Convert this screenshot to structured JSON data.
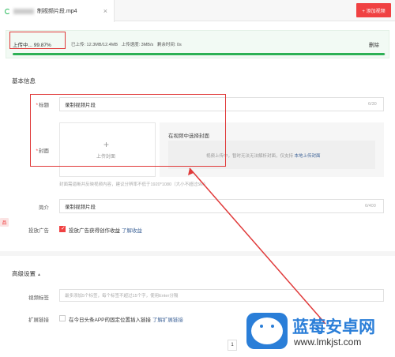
{
  "tab": {
    "file_name": "制视频片段.mp4",
    "close_icon": "×",
    "add_video_label": "+ 添加视频"
  },
  "upload": {
    "status": "上传中... 99.87%",
    "uploaded": "已上传: 12.3MB/12.4MB",
    "speed": "上传速度: 3MB/s",
    "remaining": "剩余时间: 0s",
    "delete_label": "删除",
    "progress_percent": 99.87,
    "progress_color": "#2db155"
  },
  "basic": {
    "section_title": "基本信息",
    "title_label": "标题",
    "title_value": "录制视频片段",
    "title_counter": "6/30",
    "cover_label": "封面",
    "cover_upload_label": "上传封面",
    "cover_choose_title": "在视频中选择封面",
    "cover_choose_msg": "视频上传中，暂时无法无法解析封面，仅支持",
    "cover_choose_link": "本地上传封面",
    "cover_hint": "封面需逼晰并反映视频内容，建议分辨率不低于1920*1080（大小不超过5M）",
    "intro_label": "简介",
    "intro_value": "录制视频片段",
    "intro_counter": "6/400",
    "ad_label": "投放广告",
    "ad_text": "投放广告获得创作收益",
    "ad_link": "了解收益",
    "left_badge": "品"
  },
  "advanced": {
    "section_title": "高级设置",
    "tags_label": "视频标签",
    "tags_placeholder": "最多添加5个标签，每个标签不超过15个字，使用Enter分隔",
    "ext_label": "扩展链接",
    "ext_text": "在今日头条APP的固定位置插入链接",
    "ext_link": "了解扩展链接"
  },
  "pagination": {
    "page": "1"
  },
  "watermark": {
    "brand": "蓝莓安卓网",
    "url": "www.lmkjst.com"
  },
  "colors": {
    "accent": "#f04142",
    "progress": "#2db155",
    "link": "#406599",
    "annotation": "#e03a3a"
  }
}
